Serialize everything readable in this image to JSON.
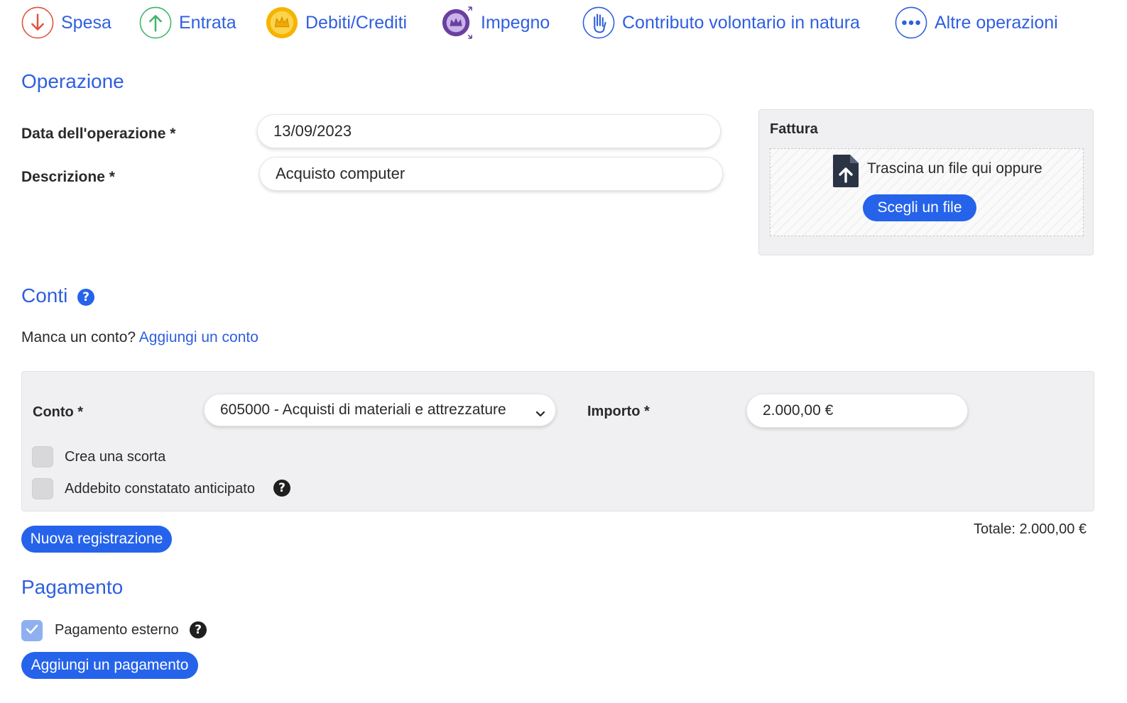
{
  "operation_types": [
    {
      "label": "Spesa",
      "icon": "arrow-down-icon",
      "color": "#e0533b"
    },
    {
      "label": "Entrata",
      "icon": "arrow-up-icon",
      "color": "#3eb56b"
    },
    {
      "label": "Debiti/Crediti",
      "icon": "crown-coin-icon",
      "color": "#f2a900"
    },
    {
      "label": "Impegno",
      "icon": "crown-badge-icon",
      "color": "#6b3fa0"
    },
    {
      "label": "Contributo volontario in natura",
      "icon": "hand-icon",
      "color": "#2f5fe0"
    },
    {
      "label": "Altre operazioni",
      "icon": "more-dots-icon",
      "color": "#2f5fe0"
    }
  ],
  "operation": {
    "title": "Operazione",
    "date_label": "Data dell'operazione *",
    "date_value": "13/09/2023",
    "description_label": "Descrizione *",
    "description_value": "Acquisto computer"
  },
  "invoice": {
    "title": "Fattura",
    "drop_text": "Trascina un file qui oppure",
    "choose_button": "Scegli un file"
  },
  "accounts": {
    "title": "Conti",
    "missing_text": "Manca un conto?",
    "add_link": "Aggiungi un conto",
    "account_label": "Conto *",
    "account_value": "605000 - Acquisti di materiali e attrezzature",
    "amount_label": "Importo *",
    "amount_value": "2.000,00 €",
    "create_stock_label": "Crea una scorta",
    "advance_charge_label": "Addebito constatato anticipato",
    "new_entry_button": "Nuova registrazione",
    "total_text": "Totale: 2.000,00 €"
  },
  "payment": {
    "title": "Pagamento",
    "external_label": "Pagamento esterno",
    "add_button": "Aggiungi un pagamento"
  },
  "colors": {
    "accent": "#2f5fe0",
    "primary_button": "#2563eb",
    "help_icon": "#2563eb"
  }
}
